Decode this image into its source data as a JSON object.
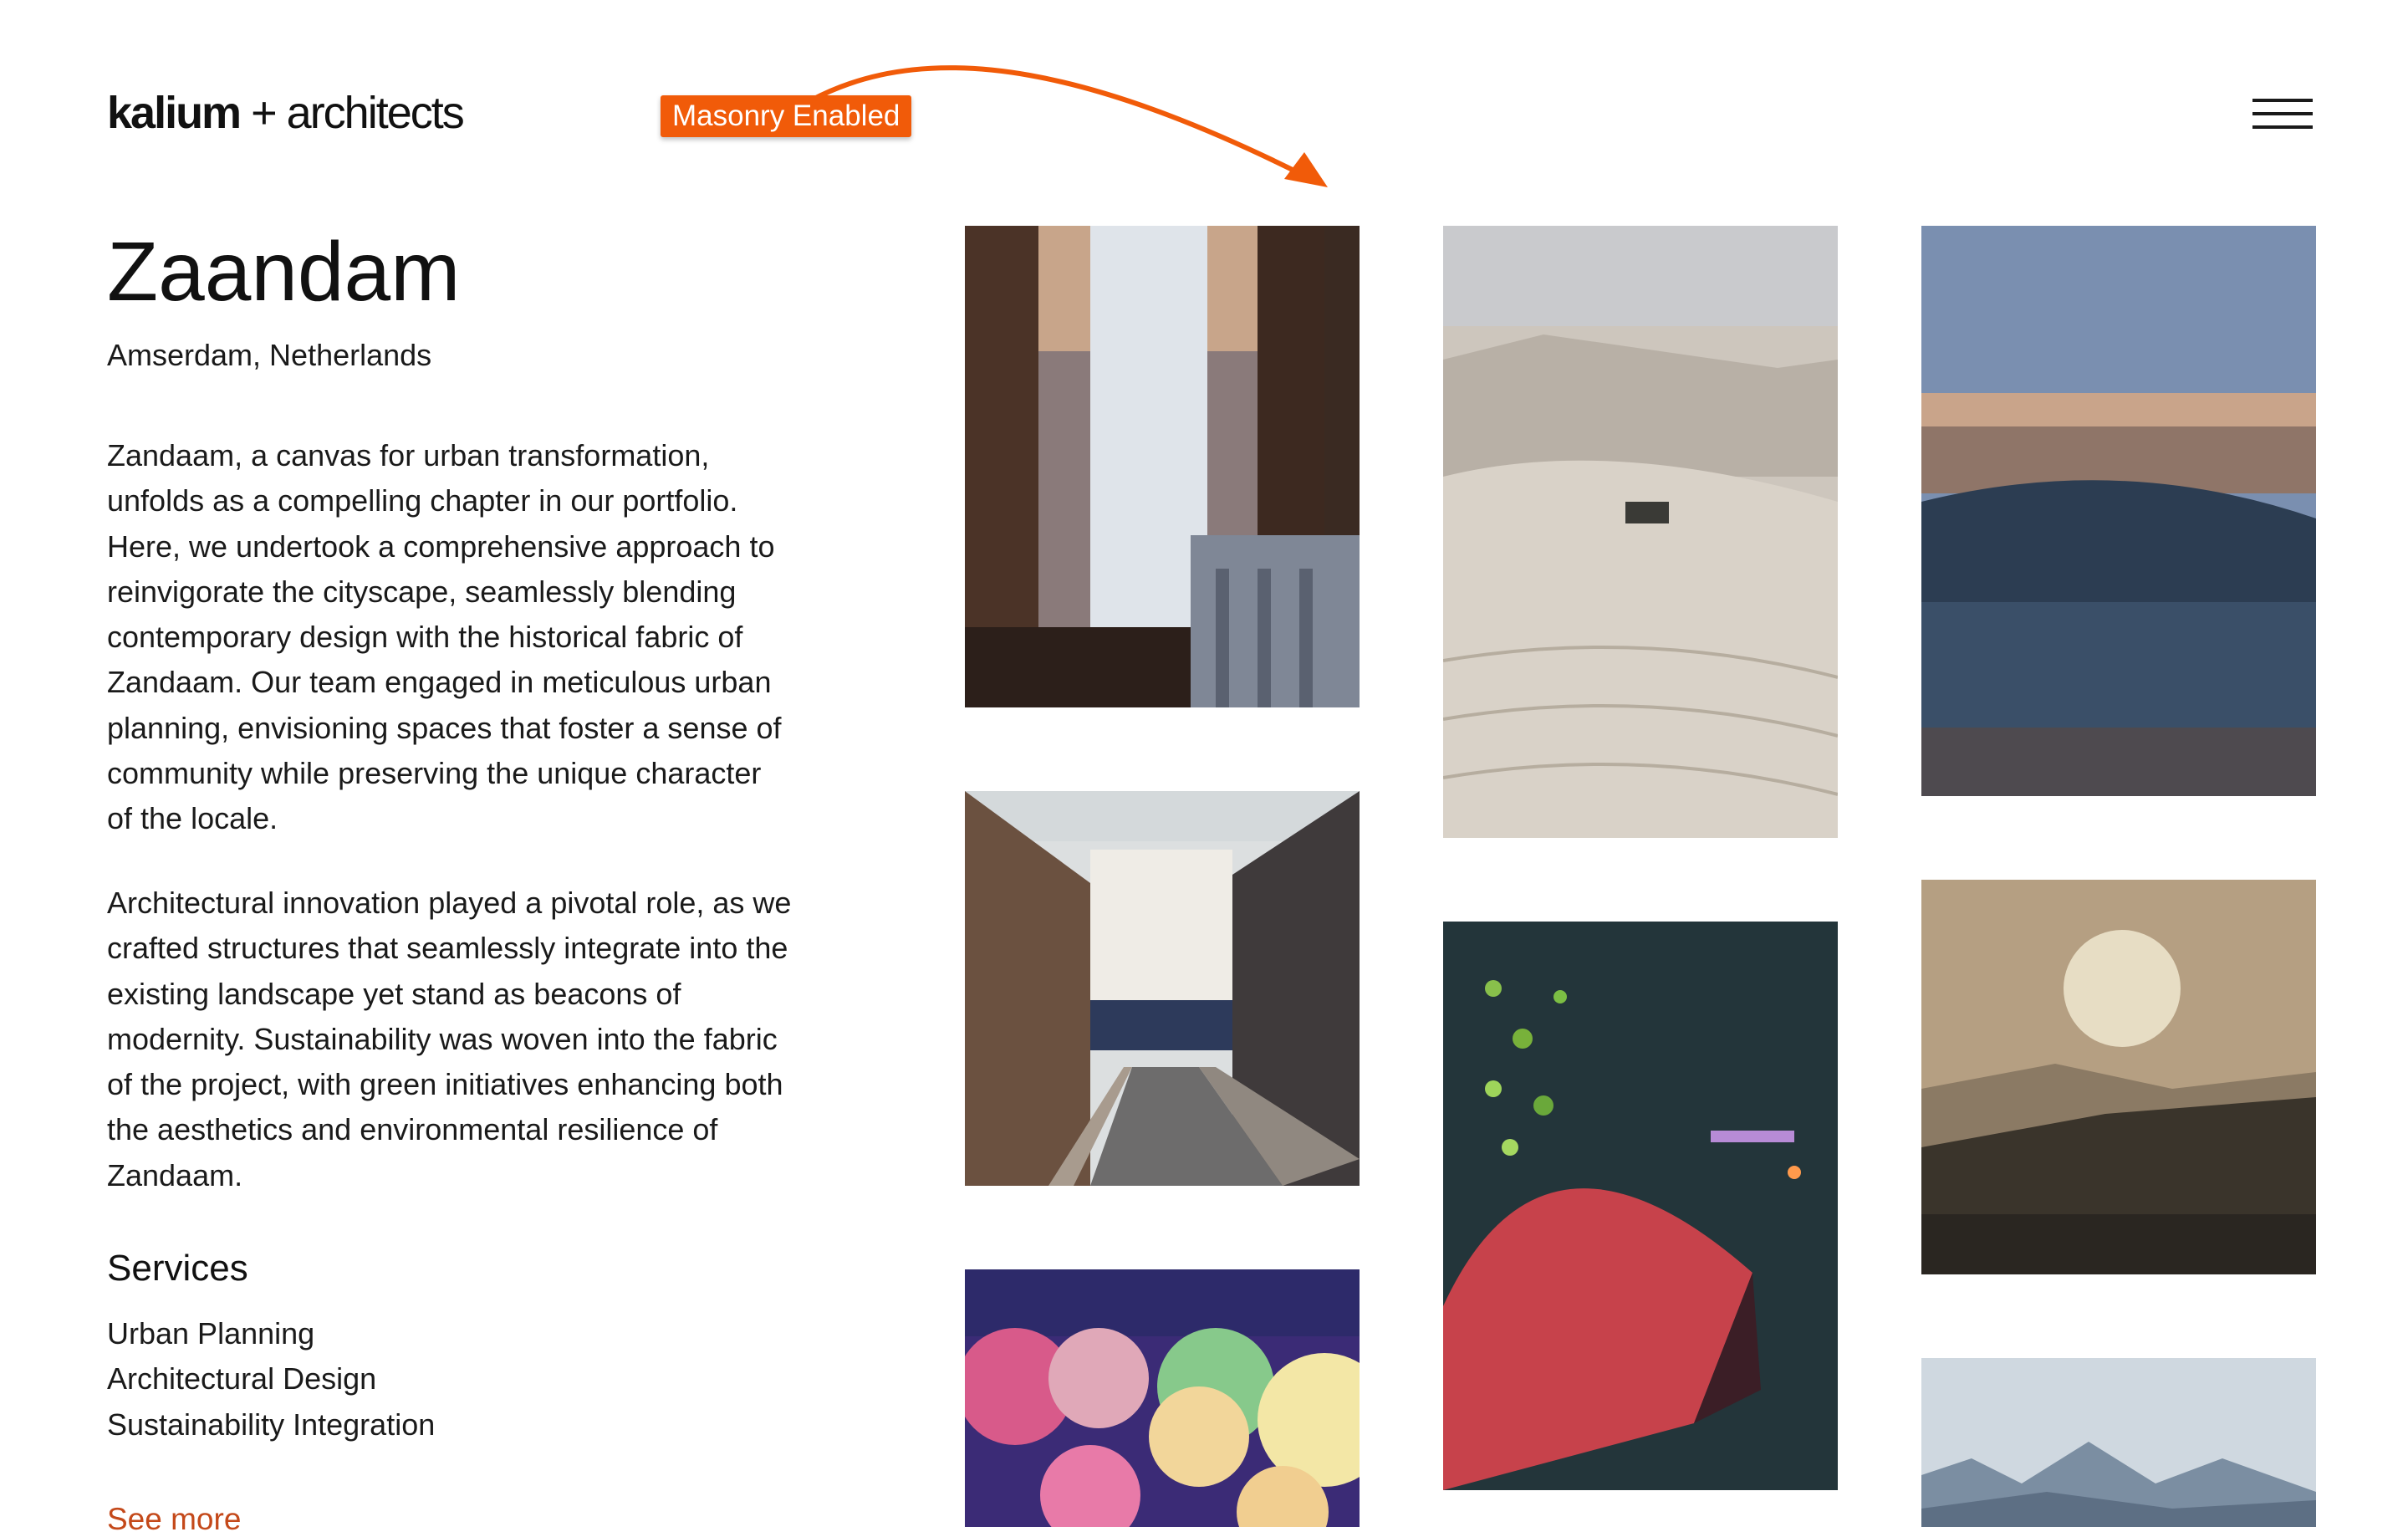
{
  "header": {
    "logo_primary": "kalium",
    "logo_plus": "+",
    "logo_secondary": "architects",
    "badge": "Masonry Enabled",
    "menu_icon": "hamburger-menu-icon"
  },
  "project": {
    "title": "Zaandam",
    "location": "Amserdam, Netherlands",
    "paragraphs": [
      "Zandaam, a canvas for urban transformation, unfolds as a compelling chapter in our portfolio. Here, we undertook a comprehensive approach to reinvigorate the cityscape, seamlessly blending contemporary design with the historical fabric of Zandaam. Our team engaged in meticulous urban planning, envisioning spaces that foster a sense of community while preserving the unique character of the locale.",
      "Architectural innovation played a pivotal role, as we crafted structures that seamlessly integrate into the existing landscape yet stand as beacons of modernity. Sustainability was woven into the fabric of the project, with green initiatives enhancing both the aesthetics and environmental resilience of Zandaam."
    ],
    "services_heading": "Services",
    "services": [
      "Urban Planning",
      "Architectural Design",
      "Sustainability Integration"
    ],
    "see_more": "See more"
  },
  "colors": {
    "accent": "#f15b09",
    "link": "#c4491a",
    "text": "#1a1a1a"
  }
}
